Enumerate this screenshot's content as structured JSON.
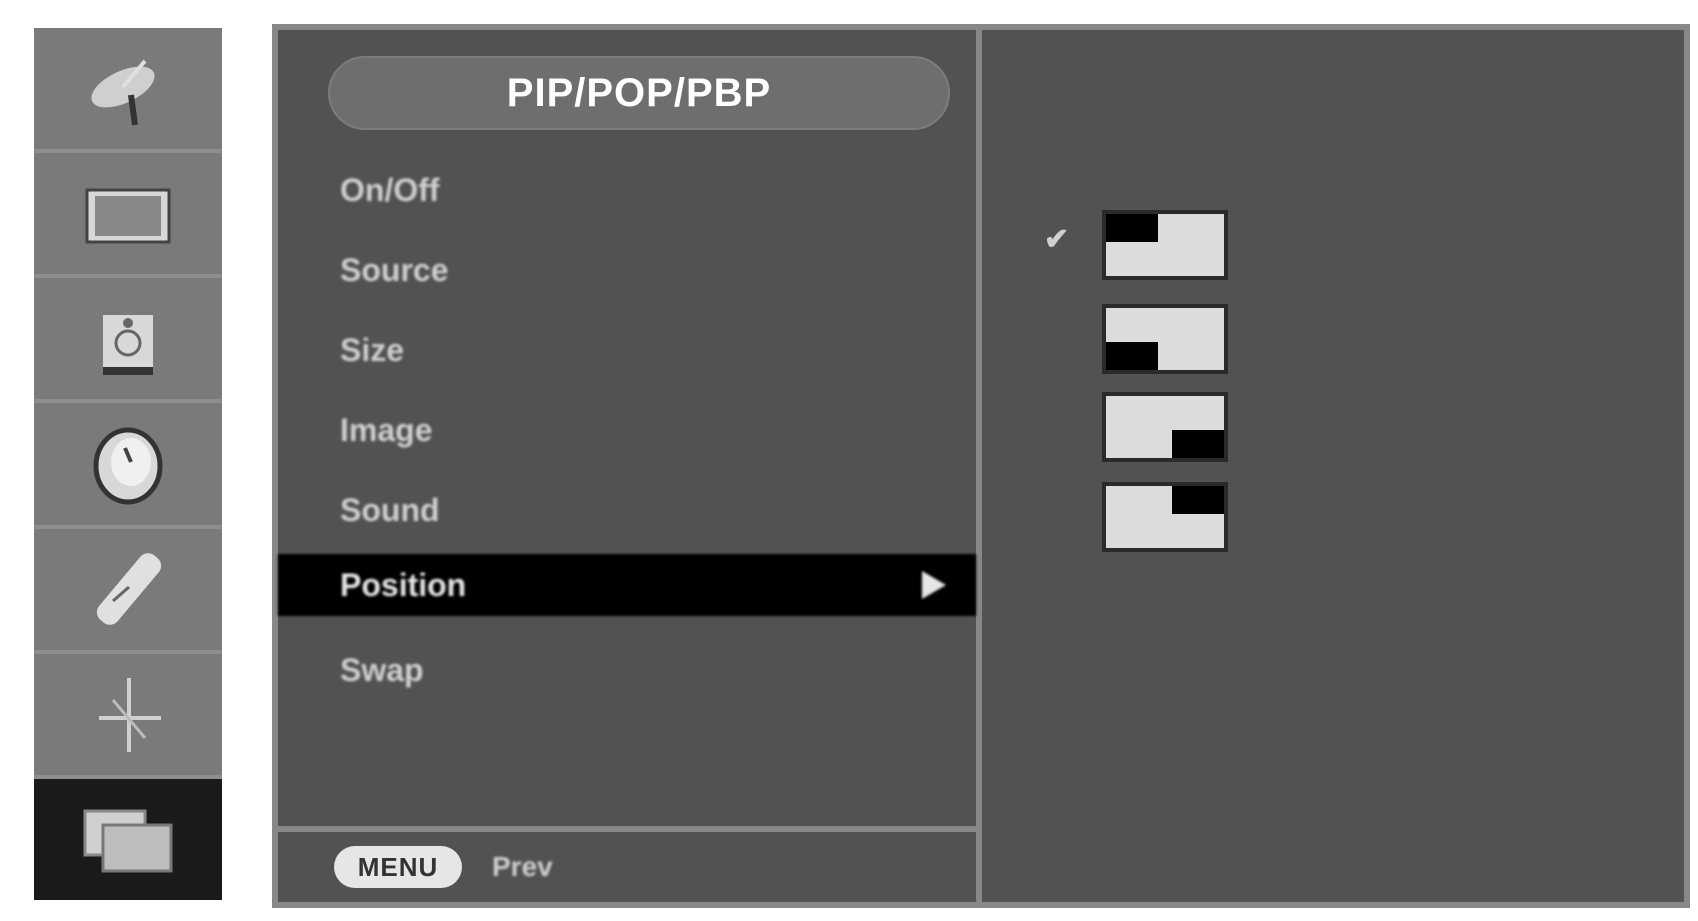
{
  "menu": {
    "title": "PIP/POP/PBP",
    "items": [
      {
        "label": "On/Off"
      },
      {
        "label": "Source"
      },
      {
        "label": "Size"
      },
      {
        "label": "Image"
      },
      {
        "label": "Sound"
      },
      {
        "label": "Position"
      },
      {
        "label": "Swap"
      }
    ],
    "selected_index": 5,
    "footer": {
      "button_label": "MENU",
      "hint": "Prev"
    }
  },
  "sidebar": {
    "items": [
      {
        "icon": "satellite-dish-icon"
      },
      {
        "icon": "picture-icon"
      },
      {
        "icon": "audio-icon"
      },
      {
        "icon": "clock-icon"
      },
      {
        "icon": "remote-control-icon"
      },
      {
        "icon": "setup-icon"
      },
      {
        "icon": "pip-icon"
      }
    ],
    "active_index": 6
  },
  "sub_panel": {
    "check_mark": "✔",
    "options": [
      {
        "name": "top-left",
        "selected": true
      },
      {
        "name": "bottom-left",
        "selected": false
      },
      {
        "name": "bottom-right",
        "selected": false
      },
      {
        "name": "top-right",
        "selected": false
      }
    ]
  }
}
